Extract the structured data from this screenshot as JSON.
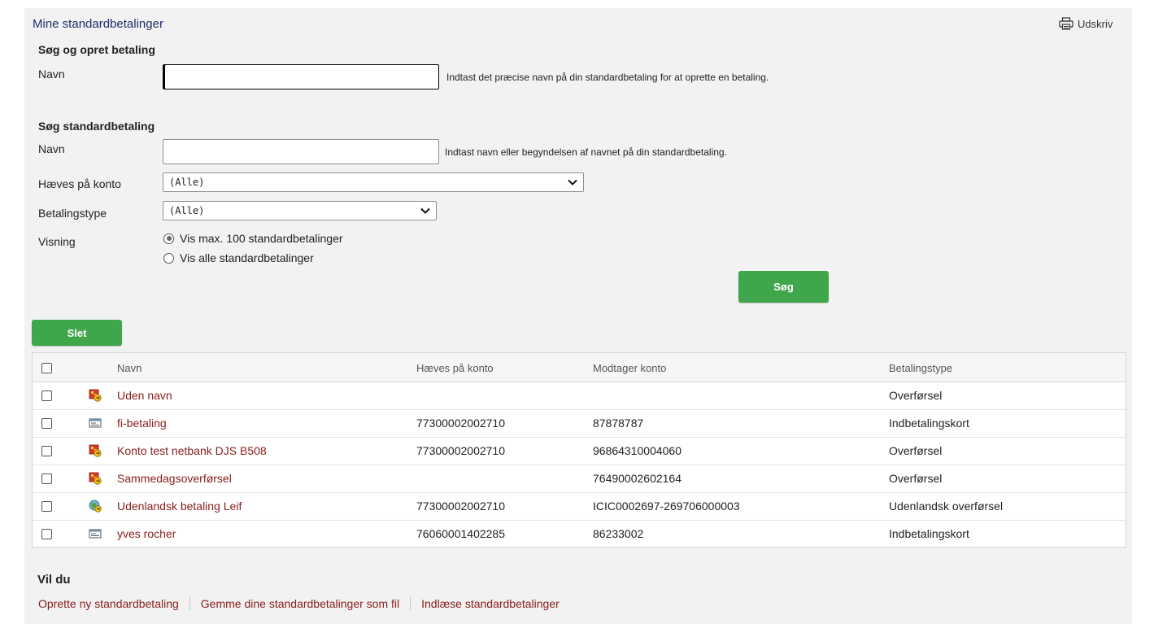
{
  "page": {
    "title": "Mine standardbetalinger",
    "print_label": "Udskriv"
  },
  "create": {
    "heading": "Søg og opret betaling",
    "name_label": "Navn",
    "name_value": "",
    "hint": "Indtast det præcise navn på din standardbetaling for at oprette en betaling."
  },
  "search": {
    "heading": "Søg standardbetaling",
    "name_label": "Navn",
    "name_value": "",
    "name_hint": "Indtast navn eller begyndelsen af navnet på din standardbetaling.",
    "account_label": "Hæves på konto",
    "account_value": "(Alle)",
    "type_label": "Betalingstype",
    "type_value": "(Alle)",
    "view_label": "Visning",
    "view_options": [
      {
        "label": "Vis max. 100 standardbetalinger",
        "selected": true
      },
      {
        "label": "Vis alle standardbetalinger",
        "selected": false
      }
    ],
    "search_button": "Søg"
  },
  "delete_button": "Slet",
  "table": {
    "columns": [
      "Navn",
      "Hæves på konto",
      "Modtager konto",
      "Betalingstype"
    ],
    "rows": [
      {
        "icon": "transfer-icon",
        "name": "Uden navn",
        "from_account": "",
        "to_account": "",
        "type": "Overførsel"
      },
      {
        "icon": "payment-card-icon",
        "name": "fi-betaling",
        "from_account": "77300002002710",
        "to_account": "87878787",
        "type": "Indbetalingskort"
      },
      {
        "icon": "transfer-icon",
        "name": "Konto test netbank DJS B508",
        "from_account": "77300002002710",
        "to_account": "96864310004060",
        "type": "Overførsel"
      },
      {
        "icon": "transfer-icon",
        "name": "Sammedagsoverførsel",
        "from_account": "",
        "to_account": "76490002602164",
        "type": "Overførsel"
      },
      {
        "icon": "foreign-transfer-icon",
        "name": "Udenlandsk betaling Leif",
        "from_account": "77300002002710",
        "to_account": "ICIC0002697-269706000003",
        "type": "Udenlandsk overførsel"
      },
      {
        "icon": "payment-card-icon",
        "name": "yves rocher",
        "from_account": "76060001402285",
        "to_account": "86233002",
        "type": "Indbetalingskort"
      }
    ]
  },
  "footer": {
    "heading": "Vil du",
    "links": [
      "Oprette ny standardbetaling",
      "Gemme dine standardbetalinger som fil",
      "Indlæse standardbetalinger"
    ]
  },
  "colors": {
    "accent_green": "#3fa64b",
    "link_red": "#8a1c1c",
    "title_blue": "#1f2d6b"
  }
}
